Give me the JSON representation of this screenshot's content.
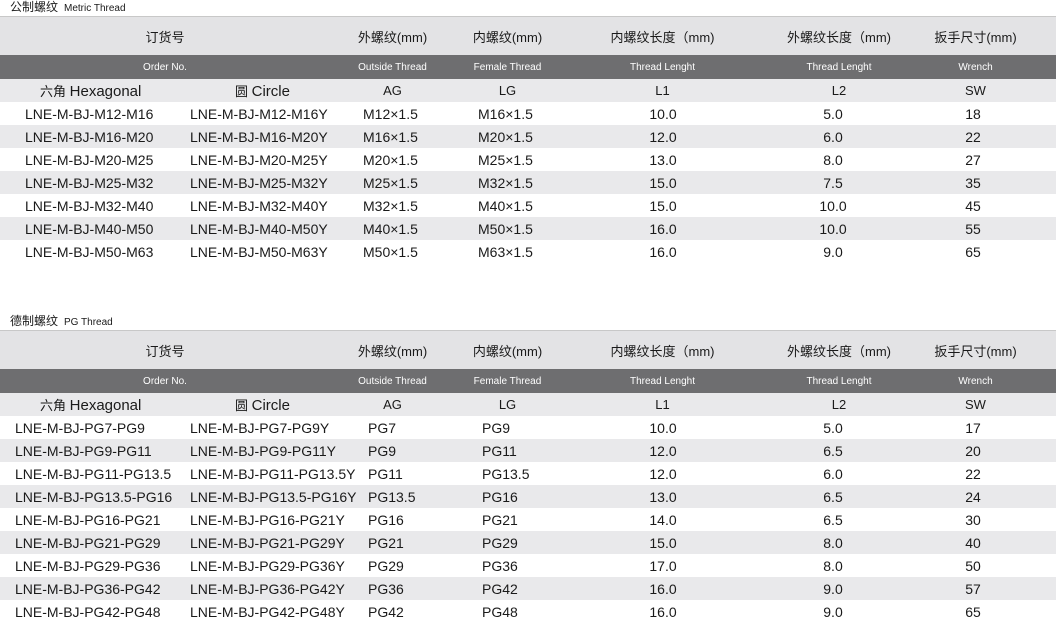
{
  "metric": {
    "title_cn": "公制螺纹",
    "title_en": "Metric Thread",
    "headers_cn": [
      "订货号",
      "外螺纹(mm)",
      "内螺纹(mm)",
      "内螺纹长度（mm)",
      "外螺纹长度（mm)",
      "扳手尺寸(mm)"
    ],
    "headers_en": [
      "Order No.",
      "Outside Thread",
      "Female Thread",
      "Thread Lenght",
      "Thread Lenght",
      "Wrench"
    ],
    "sub": {
      "hex_cn": "六角",
      "hex_en": "Hexagonal",
      "circle_cn": "圆",
      "circle_en": "Circle",
      "ag": "AG",
      "lg": "LG",
      "l1": "L1",
      "l2": "L2",
      "sw": "SW"
    },
    "rows": [
      [
        "LNE-M-BJ-M12-M16",
        "LNE-M-BJ-M12-M16Y",
        "M12×1.5",
        "M16×1.5",
        "10.0",
        "5.0",
        "18"
      ],
      [
        "LNE-M-BJ-M16-M20",
        "LNE-M-BJ-M16-M20Y",
        "M16×1.5",
        "M20×1.5",
        "12.0",
        "6.0",
        "22"
      ],
      [
        "LNE-M-BJ-M20-M25",
        "LNE-M-BJ-M20-M25Y",
        "M20×1.5",
        "M25×1.5",
        "13.0",
        "8.0",
        "27"
      ],
      [
        "LNE-M-BJ-M25-M32",
        "LNE-M-BJ-M25-M32Y",
        "M25×1.5",
        "M32×1.5",
        "15.0",
        "7.5",
        "35"
      ],
      [
        "LNE-M-BJ-M32-M40",
        "LNE-M-BJ-M32-M40Y",
        "M32×1.5",
        "M40×1.5",
        "15.0",
        "10.0",
        "45"
      ],
      [
        "LNE-M-BJ-M40-M50",
        "LNE-M-BJ-M40-M50Y",
        "M40×1.5",
        "M50×1.5",
        "16.0",
        "10.0",
        "55"
      ],
      [
        "LNE-M-BJ-M50-M63",
        "LNE-M-BJ-M50-M63Y",
        "M50×1.5",
        "M63×1.5",
        "16.0",
        "9.0",
        "65"
      ]
    ]
  },
  "pg": {
    "title_cn": "德制螺纹",
    "title_en": "PG Thread",
    "headers_cn": [
      "订货号",
      "外螺纹(mm)",
      "内螺纹(mm)",
      "内螺纹长度（mm)",
      "外螺纹长度（mm)",
      "扳手尺寸(mm)"
    ],
    "headers_en": [
      "Order No.",
      "Outside Thread",
      "Female Thread",
      "Thread Lenght",
      "Thread Lenght",
      "Wrench"
    ],
    "sub": {
      "hex_cn": "六角",
      "hex_en": "Hexagonal",
      "circle_cn": "圆",
      "circle_en": "Circle",
      "ag": "AG",
      "lg": "LG",
      "l1": "L1",
      "l2": "L2",
      "sw": "SW"
    },
    "rows": [
      [
        "LNE-M-BJ-PG7-PG9",
        "LNE-M-BJ-PG7-PG9Y",
        "PG7",
        "PG9",
        "10.0",
        "5.0",
        "17"
      ],
      [
        "LNE-M-BJ-PG9-PG11",
        "LNE-M-BJ-PG9-PG11Y",
        "PG9",
        "PG11",
        "12.0",
        "6.5",
        "20"
      ],
      [
        "LNE-M-BJ-PG11-PG13.5",
        "LNE-M-BJ-PG11-PG13.5Y",
        "PG11",
        "PG13.5",
        "12.0",
        "6.0",
        "22"
      ],
      [
        "LNE-M-BJ-PG13.5-PG16",
        "LNE-M-BJ-PG13.5-PG16Y",
        "PG13.5",
        "PG16",
        "13.0",
        "6.5",
        "24"
      ],
      [
        "LNE-M-BJ-PG16-PG21",
        "LNE-M-BJ-PG16-PG21Y",
        "PG16",
        "PG21",
        "14.0",
        "6.5",
        "30"
      ],
      [
        "LNE-M-BJ-PG21-PG29",
        "LNE-M-BJ-PG21-PG29Y",
        "PG21",
        "PG29",
        "15.0",
        "8.0",
        "40"
      ],
      [
        "LNE-M-BJ-PG29-PG36",
        "LNE-M-BJ-PG29-PG36Y",
        "PG29",
        "PG36",
        "17.0",
        "8.0",
        "50"
      ],
      [
        "LNE-M-BJ-PG36-PG42",
        "LNE-M-BJ-PG36-PG42Y",
        "PG36",
        "PG42",
        "16.0",
        "9.0",
        "57"
      ],
      [
        "LNE-M-BJ-PG42-PG48",
        "LNE-M-BJ-PG42-PG48Y",
        "PG42",
        "PG48",
        "16.0",
        "9.0",
        "65"
      ]
    ]
  }
}
